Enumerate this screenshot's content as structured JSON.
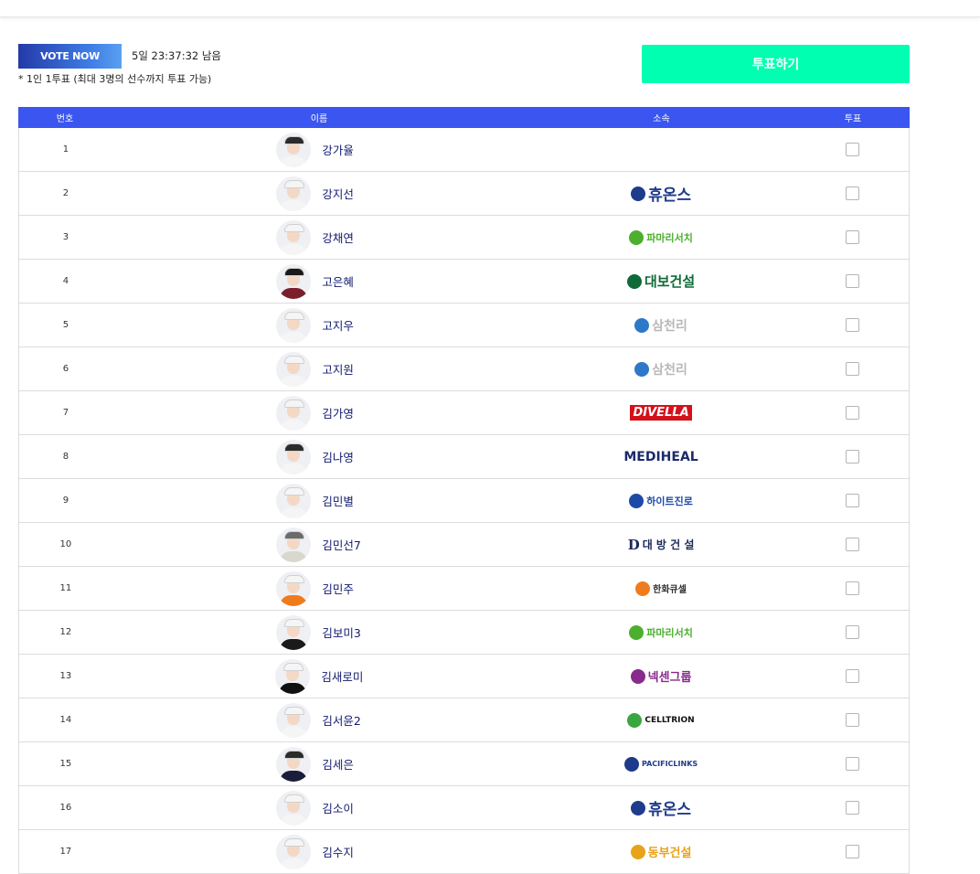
{
  "header": {
    "vote_now_label": "VOTE NOW",
    "timer_text": "5일 23:37:32 남음",
    "note_text": "* 1인 1투표 (최대 3명의 선수까지 투표 가능)",
    "vote_button_label": "투표하기"
  },
  "table": {
    "headers": {
      "number": "번호",
      "name": "이름",
      "affiliation": "소속",
      "vote": "투표"
    },
    "rows": [
      {
        "num": "1",
        "name": "강가율",
        "aff": "",
        "icon": "avatar-icon"
      },
      {
        "num": "2",
        "name": "강지선",
        "aff": "휴온스",
        "icon": "avatar-icon"
      },
      {
        "num": "3",
        "name": "강채연",
        "aff": "파마리서치",
        "icon": "avatar-icon"
      },
      {
        "num": "4",
        "name": "고은혜",
        "aff": "대보건설",
        "icon": "avatar-icon"
      },
      {
        "num": "5",
        "name": "고지우",
        "aff": "삼천리",
        "icon": "avatar-icon"
      },
      {
        "num": "6",
        "name": "고지원",
        "aff": "삼천리",
        "icon": "avatar-icon"
      },
      {
        "num": "7",
        "name": "김가영",
        "aff": "DIVELLA",
        "icon": "avatar-icon"
      },
      {
        "num": "8",
        "name": "김나영",
        "aff": "MEDIHEAL",
        "icon": "avatar-icon"
      },
      {
        "num": "9",
        "name": "김민별",
        "aff": "하이트진로",
        "icon": "avatar-icon"
      },
      {
        "num": "10",
        "name": "김민선7",
        "aff": "대 방 건 설",
        "icon": "avatar-icon"
      },
      {
        "num": "11",
        "name": "김민주",
        "aff": "한화큐셀",
        "icon": "avatar-icon"
      },
      {
        "num": "12",
        "name": "김보미3",
        "aff": "파마리서치",
        "icon": "avatar-icon"
      },
      {
        "num": "13",
        "name": "김새로미",
        "aff": "넥센그룹",
        "icon": "avatar-icon"
      },
      {
        "num": "14",
        "name": "김서윤2",
        "aff": "CELLTRION",
        "icon": "avatar-icon"
      },
      {
        "num": "15",
        "name": "김세은",
        "aff": "PACIFICLINKS",
        "icon": "avatar-icon"
      },
      {
        "num": "16",
        "name": "김소이",
        "aff": "휴온스",
        "icon": "avatar-icon"
      },
      {
        "num": "17",
        "name": "김수지",
        "aff": "동부건설",
        "icon": "avatar-icon"
      }
    ]
  },
  "colors": {
    "accent": "#3b55f0",
    "vote_button": "#00ffb0",
    "name_text": "#111a6e",
    "huons": "#1f3b8c",
    "pharma": "#4caf2e",
    "daebo": "#0e6b38",
    "samchully": "#2e78c8",
    "divella": "#d4111a",
    "mediheal": "#1c2a6b",
    "hite": "#1d4aa6",
    "daebang": "#1b2a5a",
    "hanwha": "#f07b1d",
    "nexen": "#8a2a8c",
    "celltrion": "#111111",
    "pacific": "#1e3a8a",
    "dongbu": "#e8a21c"
  }
}
